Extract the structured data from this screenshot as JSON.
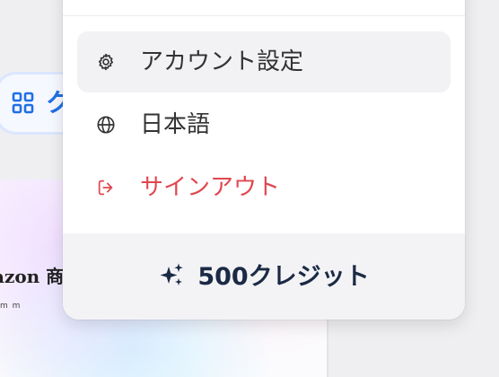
{
  "background": {
    "chip_label": "ク",
    "card_title": "azon 商品",
    "card_sub": "m m"
  },
  "menu": {
    "items": [
      {
        "label": "アカウント設定",
        "icon": "gear-icon"
      },
      {
        "label": "日本語",
        "icon": "globe-icon"
      },
      {
        "label": "サインアウト",
        "icon": "sign-out-icon"
      }
    ],
    "credits_label": "500クレジット",
    "credits_icon": "sparkles-icon"
  },
  "colors": {
    "danger": "#e0474f",
    "accent": "#1f6fe5",
    "credits_text": "#1b2a44",
    "hover_bg": "#f2f2f5"
  }
}
